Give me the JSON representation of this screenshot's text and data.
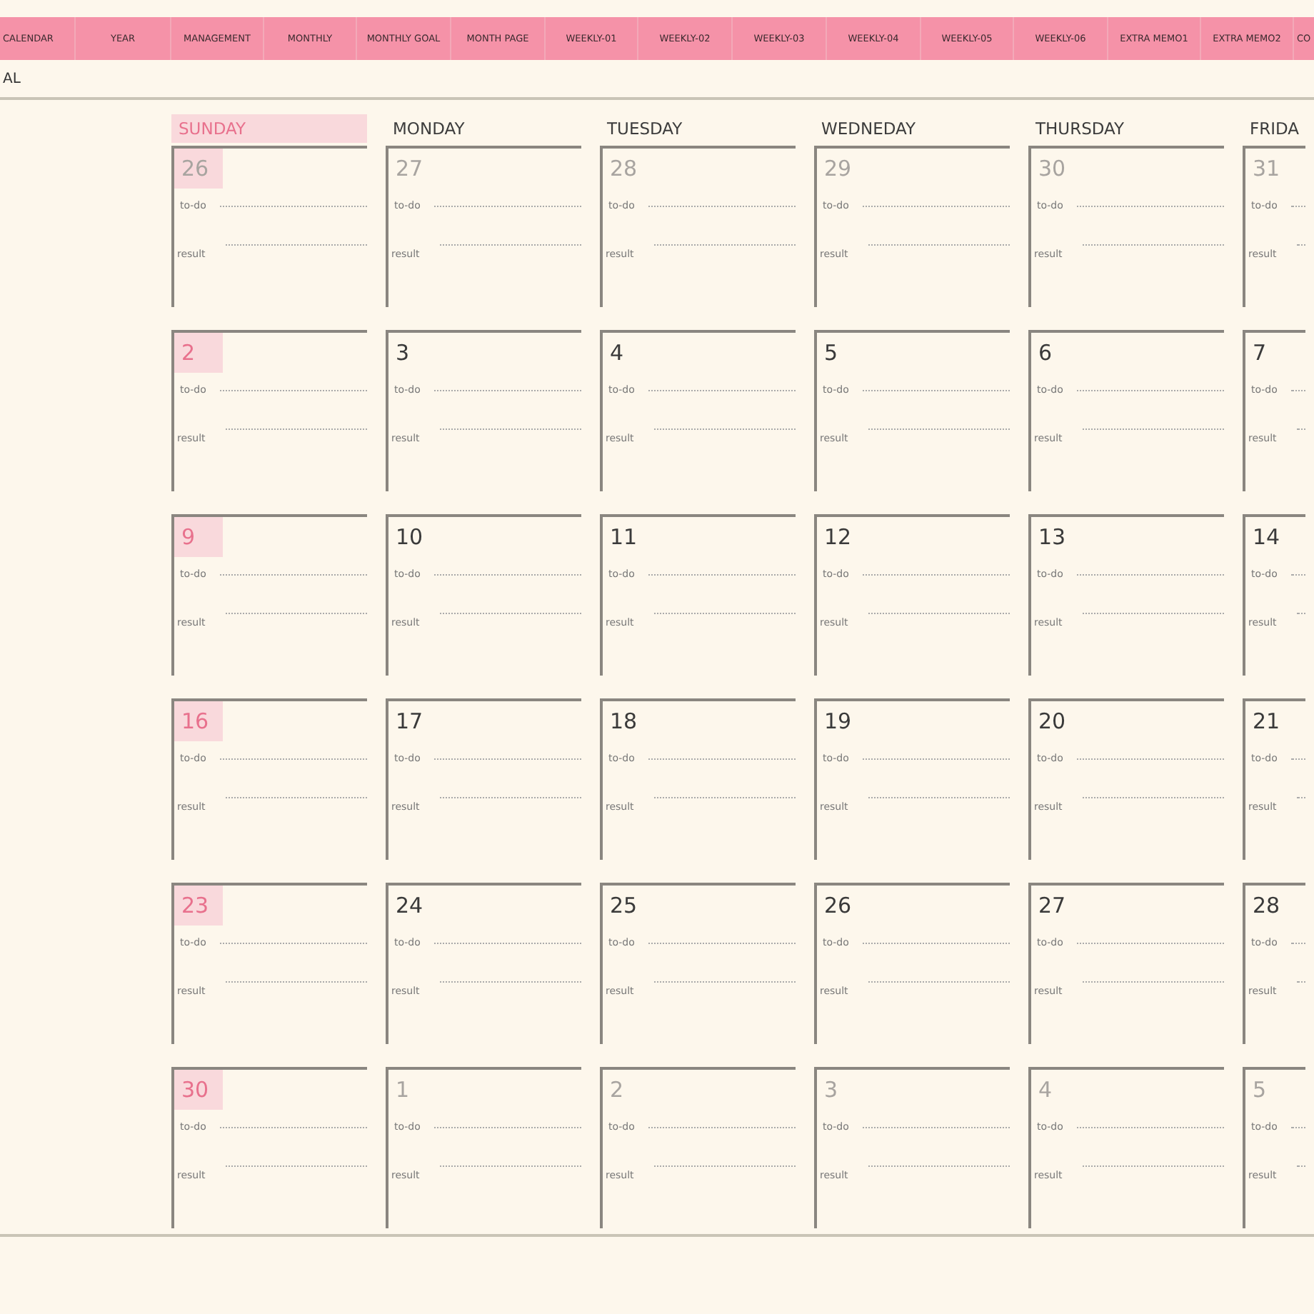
{
  "tabs": [
    {
      "label": "CALENDAR"
    },
    {
      "label": "YEAR"
    },
    {
      "label": "MANAGEMENT"
    },
    {
      "label": "MONTHLY"
    },
    {
      "label": "MONTHLY GOAL"
    },
    {
      "label": "MONTH PAGE"
    },
    {
      "label": "WEEKLY-01"
    },
    {
      "label": "WEEKLY-02"
    },
    {
      "label": "WEEKLY-03"
    },
    {
      "label": "WEEKLY-04"
    },
    {
      "label": "WEEKLY-05"
    },
    {
      "label": "WEEKLY-06"
    },
    {
      "label": "EXTRA MEMO1"
    },
    {
      "label": "EXTRA MEMO2"
    },
    {
      "label": "CO"
    }
  ],
  "section_title": "AL",
  "weekdays": [
    {
      "label": "SUNDAY",
      "highlighted": true
    },
    {
      "label": "MONDAY",
      "highlighted": false
    },
    {
      "label": "TUESDAY",
      "highlighted": false
    },
    {
      "label": "WEDNEDAY",
      "highlighted": false
    },
    {
      "label": "THURSDAY",
      "highlighted": false
    },
    {
      "label": "FRIDA",
      "highlighted": false
    }
  ],
  "weeks": [
    {
      "days": [
        {
          "day": "26",
          "muted": true,
          "todo_label": "to-do",
          "result_label": "result"
        },
        {
          "day": "27",
          "muted": true,
          "todo_label": "to-do",
          "result_label": "result"
        },
        {
          "day": "28",
          "muted": true,
          "todo_label": "to-do",
          "result_label": "result"
        },
        {
          "day": "29",
          "muted": true,
          "todo_label": "to-do",
          "result_label": "result"
        },
        {
          "day": "30",
          "muted": true,
          "todo_label": "to-do",
          "result_label": "result"
        },
        {
          "day": "31",
          "muted": true,
          "todo_label": "to-do",
          "result_label": "result"
        }
      ]
    },
    {
      "days": [
        {
          "day": "2",
          "muted": false,
          "todo_label": "to-do",
          "result_label": "result"
        },
        {
          "day": "3",
          "muted": false,
          "todo_label": "to-do",
          "result_label": "result"
        },
        {
          "day": "4",
          "muted": false,
          "todo_label": "to-do",
          "result_label": "result"
        },
        {
          "day": "5",
          "muted": false,
          "todo_label": "to-do",
          "result_label": "result"
        },
        {
          "day": "6",
          "muted": false,
          "todo_label": "to-do",
          "result_label": "result"
        },
        {
          "day": "7",
          "muted": false,
          "todo_label": "to-do",
          "result_label": "result"
        }
      ]
    },
    {
      "days": [
        {
          "day": "9",
          "muted": false,
          "todo_label": "to-do",
          "result_label": "result"
        },
        {
          "day": "10",
          "muted": false,
          "todo_label": "to-do",
          "result_label": "result"
        },
        {
          "day": "11",
          "muted": false,
          "todo_label": "to-do",
          "result_label": "result"
        },
        {
          "day": "12",
          "muted": false,
          "todo_label": "to-do",
          "result_label": "result"
        },
        {
          "day": "13",
          "muted": false,
          "todo_label": "to-do",
          "result_label": "result"
        },
        {
          "day": "14",
          "muted": false,
          "todo_label": "to-do",
          "result_label": "result"
        }
      ]
    },
    {
      "days": [
        {
          "day": "16",
          "muted": false,
          "todo_label": "to-do",
          "result_label": "result"
        },
        {
          "day": "17",
          "muted": false,
          "todo_label": "to-do",
          "result_label": "result"
        },
        {
          "day": "18",
          "muted": false,
          "todo_label": "to-do",
          "result_label": "result"
        },
        {
          "day": "19",
          "muted": false,
          "todo_label": "to-do",
          "result_label": "result"
        },
        {
          "day": "20",
          "muted": false,
          "todo_label": "to-do",
          "result_label": "result"
        },
        {
          "day": "21",
          "muted": false,
          "todo_label": "to-do",
          "result_label": "result"
        }
      ]
    },
    {
      "days": [
        {
          "day": "23",
          "muted": false,
          "todo_label": "to-do",
          "result_label": "result"
        },
        {
          "day": "24",
          "muted": false,
          "todo_label": "to-do",
          "result_label": "result"
        },
        {
          "day": "25",
          "muted": false,
          "todo_label": "to-do",
          "result_label": "result"
        },
        {
          "day": "26",
          "muted": false,
          "todo_label": "to-do",
          "result_label": "result"
        },
        {
          "day": "27",
          "muted": false,
          "todo_label": "to-do",
          "result_label": "result"
        },
        {
          "day": "28",
          "muted": false,
          "todo_label": "to-do",
          "result_label": "result"
        }
      ]
    },
    {
      "days": [
        {
          "day": "30",
          "muted": false,
          "todo_label": "to-do",
          "result_label": "result"
        },
        {
          "day": "1",
          "muted": true,
          "todo_label": "to-do",
          "result_label": "result"
        },
        {
          "day": "2",
          "muted": true,
          "todo_label": "to-do",
          "result_label": "result"
        },
        {
          "day": "3",
          "muted": true,
          "todo_label": "to-do",
          "result_label": "result"
        },
        {
          "day": "4",
          "muted": true,
          "todo_label": "to-do",
          "result_label": "result"
        },
        {
          "day": "5",
          "muted": true,
          "todo_label": "to-do",
          "result_label": "result"
        }
      ]
    }
  ]
}
